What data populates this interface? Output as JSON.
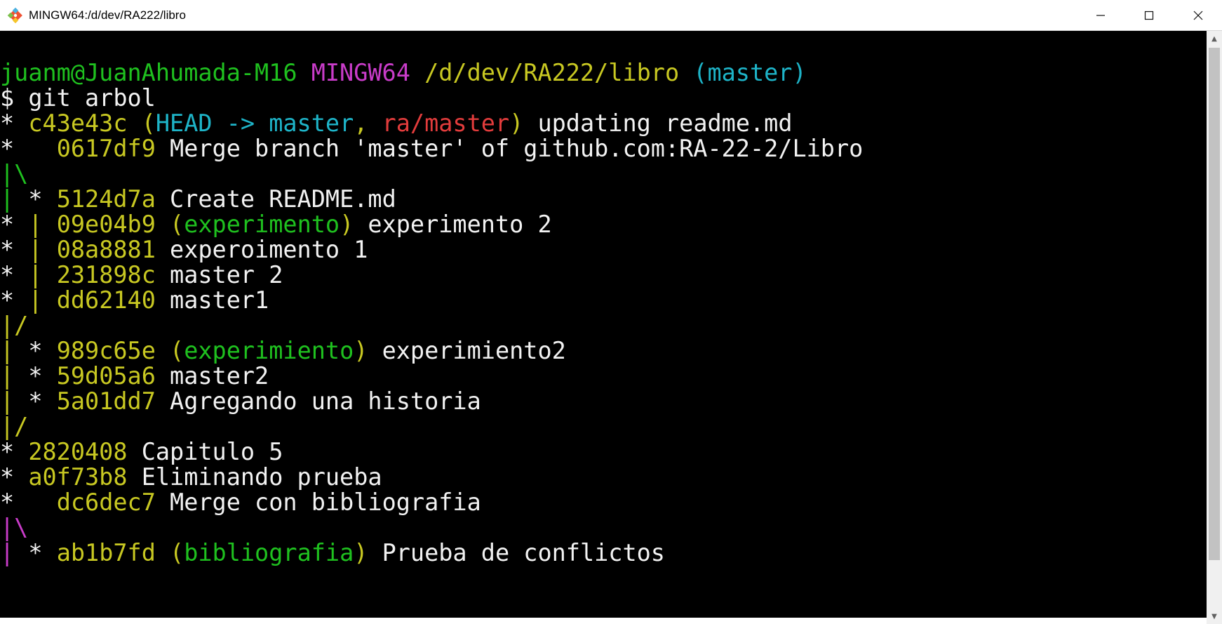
{
  "window": {
    "title": "MINGW64:/d/dev/RA222/libro",
    "controls": {
      "minimize": "—",
      "maximize": "☐",
      "close": "✕"
    }
  },
  "colors": {
    "background": "#000000",
    "green": "#1fc11f",
    "magenta": "#c93cc9",
    "yellow": "#c8c822",
    "cyan": "#1eb4c8",
    "red": "#e23c3c",
    "white": "#f2f2f2"
  },
  "terminal": {
    "prompt": {
      "user_host": "juanm@JuanAhumada-M16",
      "system": "MINGW64",
      "path": "/d/dev/RA222/libro",
      "branch": "(master)",
      "command": "$ git arbol"
    },
    "log": [
      {
        "graph": "* ",
        "graph_color": "white",
        "hash": "c43e43c",
        "refs_open": " (",
        "head": "HEAD -> master",
        "sep": ", ",
        "remote": "ra/master",
        "refs_close": ")",
        "msg": " updating readme.md"
      },
      {
        "graph": "*   ",
        "graph_color": "white",
        "hash": "0617df9",
        "msg": " Merge branch 'master' of github.com:RA-22-2/Libro"
      },
      {
        "graph": "|\\",
        "graph_color": "green"
      },
      {
        "graph_a": "| ",
        "graph_a_color": "green",
        "graph_b": "* ",
        "graph_b_color": "white",
        "hash": "5124d7a",
        "msg": " Create README.md"
      },
      {
        "graph_a": "* ",
        "graph_a_color": "white",
        "graph_b": "| ",
        "graph_b_color": "yellow",
        "hash": "09e04b9",
        "refs_open": " (",
        "branch": "experimento",
        "refs_close": ")",
        "msg": " experimento 2"
      },
      {
        "graph_a": "* ",
        "graph_a_color": "white",
        "graph_b": "| ",
        "graph_b_color": "yellow",
        "hash": "08a8881",
        "msg": " experoimento 1"
      },
      {
        "graph_a": "* ",
        "graph_a_color": "white",
        "graph_b": "| ",
        "graph_b_color": "yellow",
        "hash": "231898c",
        "msg": " master 2"
      },
      {
        "graph_a": "* ",
        "graph_a_color": "white",
        "graph_b": "| ",
        "graph_b_color": "yellow",
        "hash": "dd62140",
        "msg": " master1"
      },
      {
        "graph": "|/",
        "graph_color": "yellow"
      },
      {
        "graph_a": "| ",
        "graph_a_color": "yellow",
        "graph_b": "* ",
        "graph_b_color": "white",
        "hash": "989c65e",
        "refs_open": " (",
        "branch": "experimiento",
        "refs_close": ")",
        "msg": " experimiento2"
      },
      {
        "graph_a": "| ",
        "graph_a_color": "yellow",
        "graph_b": "* ",
        "graph_b_color": "white",
        "hash": "59d05a6",
        "msg": " master2"
      },
      {
        "graph_a": "| ",
        "graph_a_color": "yellow",
        "graph_b": "* ",
        "graph_b_color": "white",
        "hash": "5a01dd7",
        "msg": " Agregando una historia"
      },
      {
        "graph": "|/",
        "graph_color": "yellow"
      },
      {
        "graph": "* ",
        "graph_color": "white",
        "hash": "2820408",
        "msg": " Capitulo 5"
      },
      {
        "graph": "* ",
        "graph_color": "white",
        "hash": "a0f73b8",
        "msg": " Eliminando prueba"
      },
      {
        "graph": "*   ",
        "graph_color": "white",
        "hash": "dc6dec7",
        "msg": " Merge con bibliografia"
      },
      {
        "graph": "|\\",
        "graph_color": "magenta"
      },
      {
        "graph_a": "| ",
        "graph_a_color": "magenta",
        "graph_b": "* ",
        "graph_b_color": "white",
        "hash": "ab1b7fd",
        "refs_open": " (",
        "branch": "bibliografia",
        "refs_close": ")",
        "msg": " Prueba de conflictos"
      }
    ]
  }
}
